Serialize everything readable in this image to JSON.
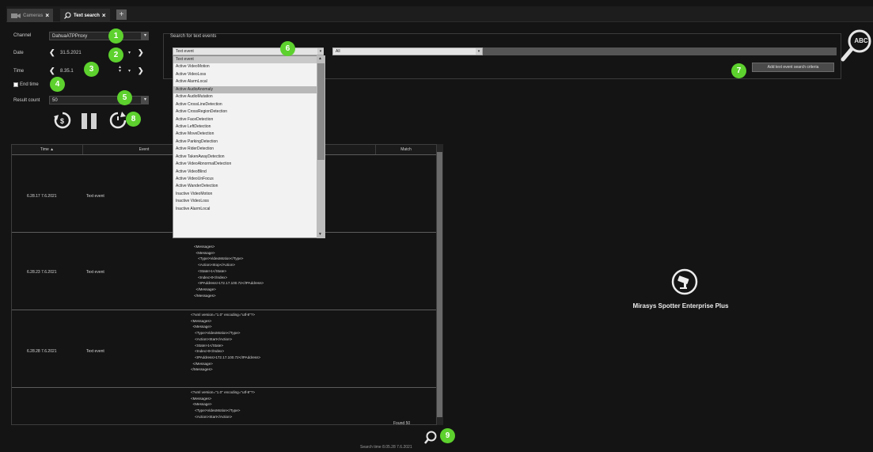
{
  "tabs": [
    {
      "label": "Cameras",
      "active": false,
      "icon": "camera-icon"
    },
    {
      "label": "Text search",
      "active": true,
      "icon": "search-icon"
    }
  ],
  "add_tab_label": "+",
  "left_panel": {
    "channel_label": "Channel",
    "channel_value": "DahuaATPProxy",
    "date_label": "Date",
    "date_value": "31.5.2021",
    "time_label": "Time",
    "time_value": "8.35.1",
    "end_time_label": "End time",
    "end_time_checked": false,
    "result_count_label": "Result count",
    "result_count_value": "50"
  },
  "search": {
    "group_title": "Search for text events",
    "type_value": "Text event",
    "value_value": "All",
    "add_criteria_label": "Add text event search criteria",
    "abc_label": "ABC"
  },
  "dropdown_items": [
    "Text event",
    "Active VideoMotion",
    "Active VideoLoss",
    "Active AlarmLocal",
    "Active AudioAnomaly",
    "Active AudioMutation",
    "Active CrossLineDetection",
    "Active CrossRegionDetection",
    "Active FaceDetection",
    "Active LeftDetection",
    "Active MoveDetection",
    "Active ParkingDetection",
    "Active RiderDetection",
    "Active TakenAwayDetection",
    "Active VideoAbnormalDetection",
    "Active VideoBlind",
    "Active VideoUnFocus",
    "Active WanderDetection",
    "Inactive VideoMotion",
    "Inactive VideoLoss",
    "Inactive AlarmLocal"
  ],
  "dropdown_selected_index": 0,
  "dropdown_highlight_index": 4,
  "table": {
    "headers": [
      "Time ▲",
      "Event",
      "",
      "Match"
    ],
    "rows": [
      {
        "time": "6.28.17 7.6.2021",
        "event": "Text event",
        "xml": ""
      },
      {
        "time": "6.28.23 7.6.2021",
        "event": "Text event",
        "xml": "<Messages>\n  <Message>\n    <Type>VideoMotion</Type>\n    <Action>Stop</Action>\n    <State>1</State>\n    <Index>0</Index>\n    <IPAddress>172.17.100.72</IPAddress>\n  </Message>\n</Messages>"
      },
      {
        "time": "6.28.28 7.6.2021",
        "event": "Text event",
        "xml": "<?xml version=\"1.0\" encoding=\"utf-8\"?>\n<Messages>\n  <Message>\n    <Type>VideoMotion</Type>\n    <Action>Start</Action>\n    <State>1</State>\n    <Index>0</Index>\n    <IPAddress>172.17.100.72</IPAddress>\n  </Message>\n</Messages>"
      },
      {
        "time": "",
        "event": "",
        "xml": "<?xml version=\"1.0\" encoding=\"utf-8\"?>\n<Messages>\n  <Message>\n    <Type>VideoMotion</Type>\n    <Action>Start</Action>"
      }
    ]
  },
  "footer": {
    "found_text": "Found 50",
    "search_time_text": "Search time 8.05.28 7.6.2021"
  },
  "right_panel": {
    "brand_text": "Mirasys Spotter Enterprise Plus"
  },
  "badges": [
    "1",
    "2",
    "3",
    "4",
    "5",
    "6",
    "7",
    "8",
    "9"
  ],
  "colors": {
    "badge": "#5dd12e",
    "background": "#141414"
  }
}
